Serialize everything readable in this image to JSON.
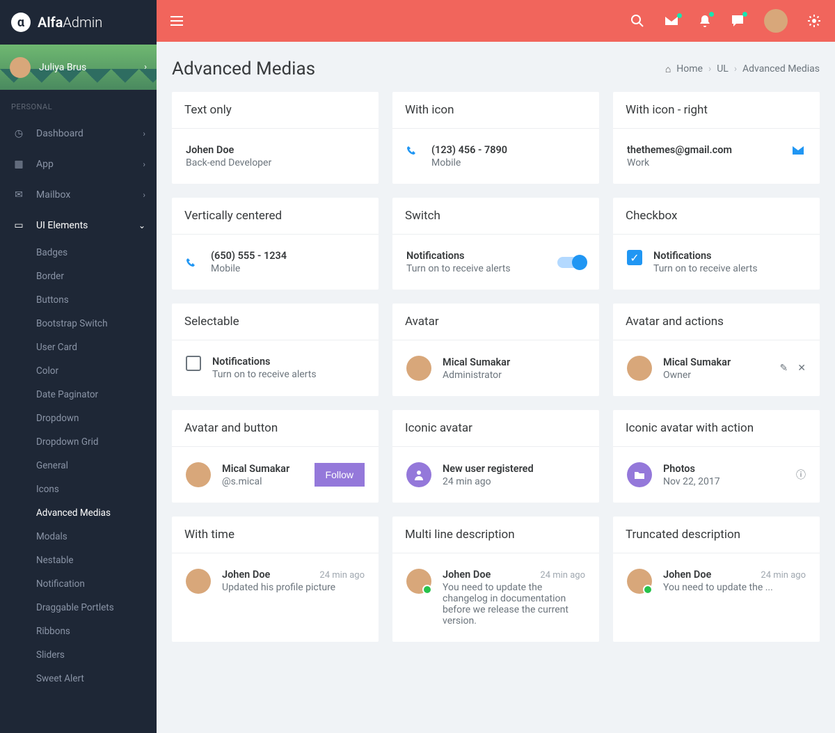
{
  "brand": {
    "strong": "Alfa",
    "light": "Admin"
  },
  "user": {
    "name": "Juliya Brus"
  },
  "sidebar": {
    "section": "PERSONAL",
    "items": [
      {
        "label": "Dashboard",
        "icon": "gauge"
      },
      {
        "label": "App",
        "icon": "grid"
      },
      {
        "label": "Mailbox",
        "icon": "mail"
      },
      {
        "label": "UI Elements",
        "icon": "laptop",
        "active": true
      }
    ],
    "sub": [
      "Badges",
      "Border",
      "Buttons",
      "Bootstrap Switch",
      "User Card",
      "Color",
      "Date Paginator",
      "Dropdown",
      "Dropdown Grid",
      "General",
      "Icons",
      "Advanced Medias",
      "Modals",
      "Nestable",
      "Notification",
      "Draggable Portlets",
      "Ribbons",
      "Sliders",
      "Sweet Alert"
    ]
  },
  "page": {
    "title": "Advanced Medias"
  },
  "breadcrumb": {
    "home": "Home",
    "mid": "UL",
    "current": "Advanced Medias"
  },
  "cards": {
    "text_only": {
      "title": "Text only",
      "name": "Johen Doe",
      "role": "Back-end Developer"
    },
    "with_icon": {
      "title": "With icon",
      "phone": "(123) 456 - 7890",
      "type": "Mobile"
    },
    "with_icon_right": {
      "title": "With icon - right",
      "email": "thethemes@gmail.com",
      "type": "Work"
    },
    "vcentered": {
      "title": "Vertically centered",
      "phone": "(650) 555 - 1234",
      "type": "Mobile"
    },
    "switch": {
      "title": "Switch",
      "name": "Notifications",
      "desc": "Turn on to receive alerts"
    },
    "checkbox": {
      "title": "Checkbox",
      "name": "Notifications",
      "desc": "Turn on to receive alerts"
    },
    "selectable": {
      "title": "Selectable",
      "name": "Notifications",
      "desc": "Turn on to receive alerts"
    },
    "avatar": {
      "title": "Avatar",
      "name": "Mical Sumakar",
      "role": "Administrator"
    },
    "avatar_actions": {
      "title": "Avatar and actions",
      "name": "Mical Sumakar",
      "role": "Owner"
    },
    "avatar_button": {
      "title": "Avatar and button",
      "name": "Mical Sumakar",
      "handle": "@s.mical",
      "btn": "Follow"
    },
    "iconic": {
      "title": "Iconic avatar",
      "name": "New user registered",
      "time": "24 min ago"
    },
    "iconic_action": {
      "title": "Iconic avatar with action",
      "name": "Photos",
      "date": "Nov 22, 2017"
    },
    "with_time": {
      "title": "With time",
      "name": "Johen Doe",
      "time": "24 min ago",
      "desc": "Updated his profile picture"
    },
    "multiline": {
      "title": "Multi line description",
      "name": "Johen Doe",
      "time": "24 min ago",
      "desc": "You need to update the changelog in documentation before we release the current version."
    },
    "truncated": {
      "title": "Truncated description",
      "name": "Johen Doe",
      "time": "24 min ago",
      "desc": "You need to update the ..."
    }
  }
}
